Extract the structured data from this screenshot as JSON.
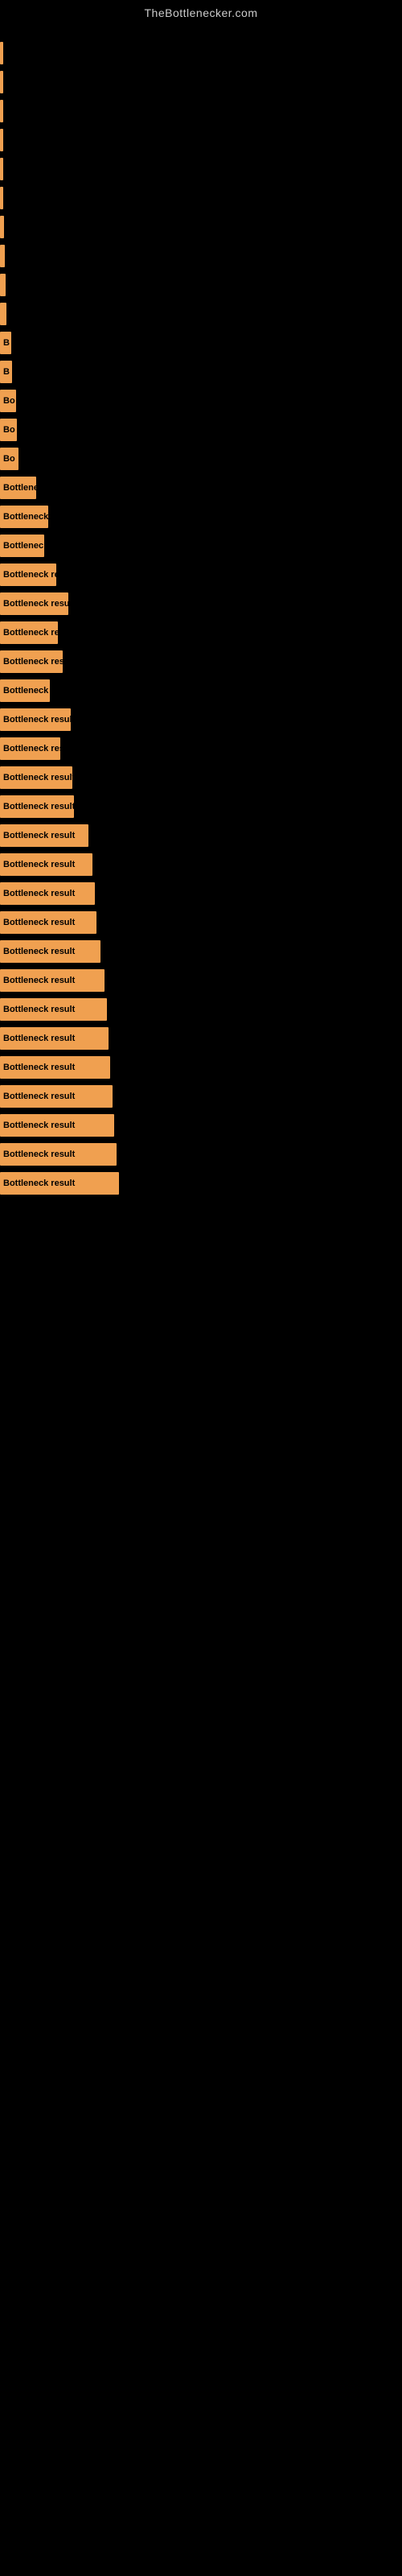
{
  "site": {
    "title": "TheBottlenecker.com"
  },
  "bars": [
    {
      "id": 1,
      "label": "",
      "width": 2
    },
    {
      "id": 2,
      "label": "",
      "width": 2
    },
    {
      "id": 3,
      "label": "",
      "width": 2
    },
    {
      "id": 4,
      "label": "",
      "width": 3
    },
    {
      "id": 5,
      "label": "",
      "width": 3
    },
    {
      "id": 6,
      "label": "",
      "width": 4
    },
    {
      "id": 7,
      "label": "",
      "width": 5
    },
    {
      "id": 8,
      "label": "",
      "width": 6
    },
    {
      "id": 9,
      "label": "",
      "width": 7
    },
    {
      "id": 10,
      "label": "",
      "width": 8
    },
    {
      "id": 11,
      "label": "B",
      "width": 14
    },
    {
      "id": 12,
      "label": "B",
      "width": 15
    },
    {
      "id": 13,
      "label": "Bo",
      "width": 20
    },
    {
      "id": 14,
      "label": "Bo",
      "width": 21
    },
    {
      "id": 15,
      "label": "Bo",
      "width": 23
    },
    {
      "id": 16,
      "label": "Bottlene",
      "width": 45
    },
    {
      "id": 17,
      "label": "Bottleneck r",
      "width": 60
    },
    {
      "id": 18,
      "label": "Bottlenec",
      "width": 55
    },
    {
      "id": 19,
      "label": "Bottleneck res",
      "width": 70
    },
    {
      "id": 20,
      "label": "Bottleneck result",
      "width": 85
    },
    {
      "id": 21,
      "label": "Bottleneck res",
      "width": 72
    },
    {
      "id": 22,
      "label": "Bottleneck resu",
      "width": 78
    },
    {
      "id": 23,
      "label": "Bottleneck r",
      "width": 62
    },
    {
      "id": 24,
      "label": "Bottleneck result",
      "width": 88
    },
    {
      "id": 25,
      "label": "Bottleneck res",
      "width": 75
    },
    {
      "id": 26,
      "label": "Bottleneck result",
      "width": 90
    },
    {
      "id": 27,
      "label": "Bottleneck result",
      "width": 92
    },
    {
      "id": 28,
      "label": "Bottleneck result",
      "width": 110
    },
    {
      "id": 29,
      "label": "Bottleneck result",
      "width": 115
    },
    {
      "id": 30,
      "label": "Bottleneck result",
      "width": 118
    },
    {
      "id": 31,
      "label": "Bottleneck result",
      "width": 120
    },
    {
      "id": 32,
      "label": "Bottleneck result",
      "width": 125
    },
    {
      "id": 33,
      "label": "Bottleneck result",
      "width": 130
    },
    {
      "id": 34,
      "label": "Bottleneck result",
      "width": 133
    },
    {
      "id": 35,
      "label": "Bottleneck result",
      "width": 135
    },
    {
      "id": 36,
      "label": "Bottleneck result",
      "width": 137
    },
    {
      "id": 37,
      "label": "Bottleneck result",
      "width": 140
    },
    {
      "id": 38,
      "label": "Bottleneck result",
      "width": 142
    },
    {
      "id": 39,
      "label": "Bottleneck result",
      "width": 145
    },
    {
      "id": 40,
      "label": "Bottleneck result",
      "width": 148
    }
  ]
}
